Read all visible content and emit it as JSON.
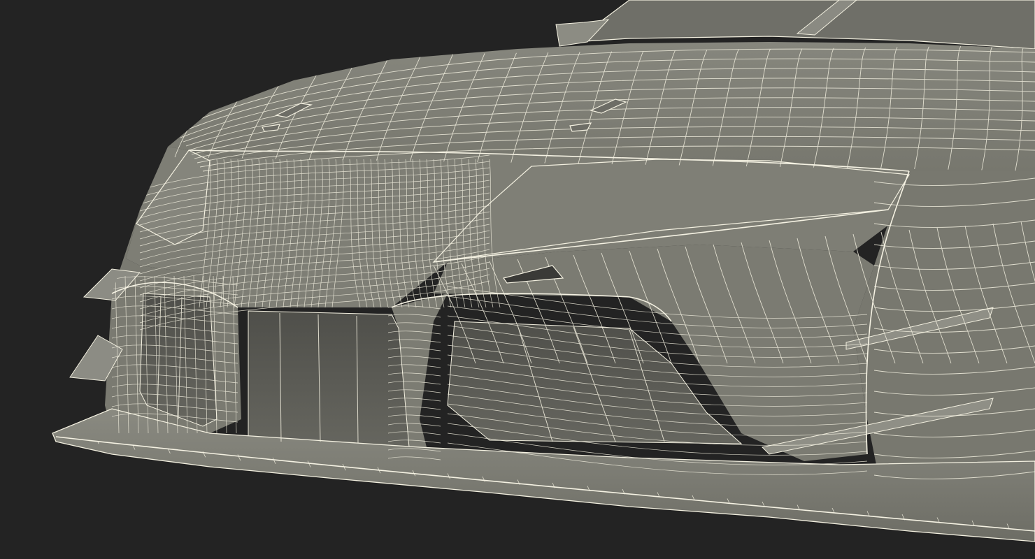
{
  "scene": {
    "subject": "car-front-wireframe",
    "background_color": "#232323",
    "surface_color": "#7b7b72",
    "surface_shadow_color": "#55554f",
    "surface_highlight_color": "#8b8b82",
    "wire_color": "#f3f0e0"
  }
}
